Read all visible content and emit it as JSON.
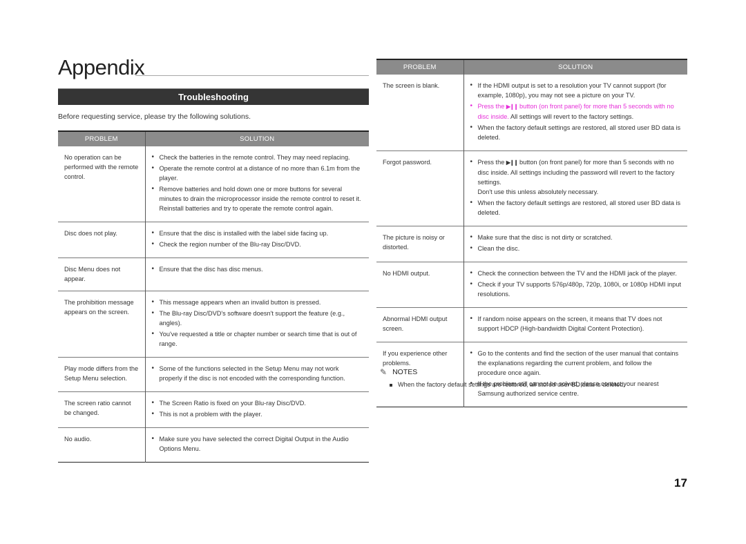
{
  "page": {
    "title": "Appendix",
    "section_title": "Troubleshooting",
    "intro": "Before requesting service, please try the following solutions.",
    "page_number": "17",
    "accent_color": "#e62ed8"
  },
  "table_headers": {
    "problem": "PROBLEM",
    "solution": "SOLUTION"
  },
  "left_table": {
    "rows": [
      {
        "problem": "No operation can be performed with the remote control.",
        "solutions": [
          "Check the batteries in the remote control. They may need replacing.",
          "Operate the remote control at a distance of no more than 6.1m from the player.",
          "Remove batteries and hold down one or more buttons for several minutes to drain the microprocessor inside the remote control to reset it. Reinstall batteries and try to operate the remote control again."
        ]
      },
      {
        "problem": "Disc does not play.",
        "solutions": [
          "Ensure that the disc is installed with the label side facing up.",
          "Check the region number of the Blu-ray Disc/DVD."
        ]
      },
      {
        "problem": "Disc Menu does not appear.",
        "solutions": [
          "Ensure that the disc has disc menus."
        ]
      },
      {
        "problem": "The prohibition message appears on the screen.",
        "solutions": [
          "This message appears when an invalid button is pressed.",
          "The Blu-ray Disc/DVD's software doesn't support the feature (e.g., angles).",
          "You've requested a title or chapter number or search time that is out of range."
        ]
      },
      {
        "problem": "Play mode differs from the Setup Menu selection.",
        "solutions": [
          "Some of the functions selected in the Setup Menu may not work properly if the disc is not encoded with the corresponding function."
        ]
      },
      {
        "problem": "The screen ratio cannot be changed.",
        "solutions": [
          "The Screen Ratio is fixed on your Blu-ray Disc/DVD.",
          "This is not a problem with the player."
        ]
      },
      {
        "problem": "No audio.",
        "solutions": [
          "Make sure you have selected the correct Digital Output in the Audio Options Menu."
        ]
      }
    ]
  },
  "right_table": {
    "rows": [
      {
        "problem": "The screen is blank.",
        "solutions": [
          {
            "text": "If the HDMI output is set to a resolution your TV cannot support (for example, 1080p), you may not see a picture on your TV."
          },
          {
            "highlight_pre": "Press the ",
            "icon": "▶❙❙",
            "highlight_post": " button (on front panel) for more than 5 seconds with no disc inside.",
            "text": " All settings will revert to the factory settings."
          },
          {
            "text": "When the factory default settings are restored, all stored user BD data is deleted."
          }
        ]
      },
      {
        "problem": "Forgot password.",
        "solutions": [
          {
            "pre": "Press the ",
            "icon": "▶❙❙",
            "text": " button (on front panel) for more than 5 seconds with no disc inside. All settings including the password will revert to the factory settings.",
            "extra": "Don't use this unless absolutely necessary."
          },
          {
            "text": "When the factory default settings are restored, all stored user BD data is deleted."
          }
        ]
      },
      {
        "problem": "The picture is noisy or distorted.",
        "solutions": [
          {
            "text": "Make sure that the disc is not dirty or scratched."
          },
          {
            "text": "Clean the disc."
          }
        ]
      },
      {
        "problem": "No HDMI output.",
        "solutions": [
          {
            "text": "Check the connection between the TV and the HDMI jack of the player."
          },
          {
            "text": "Check if your TV supports 576p/480p, 720p, 1080i, or 1080p HDMI input resolutions."
          }
        ]
      },
      {
        "problem": "Abnormal HDMI output screen.",
        "solutions": [
          {
            "text": "If random noise appears on the screen, it means that TV does not support HDCP (High-bandwidth Digital Content Protection)."
          }
        ]
      },
      {
        "problem": "If you experience other problems.",
        "solutions": [
          {
            "text": "Go to the contents and find the section of the user manual that contains the explanations regarding the current problem, and follow the procedure once again."
          },
          {
            "text": "If the problem still cannot be solved, please contact your nearest Samsung authorized service centre."
          }
        ]
      }
    ]
  },
  "notes": {
    "icon": "pencil-icon",
    "title": "NOTES",
    "items": [
      "When the factory default settings are restored, all stored user BD data is deleted."
    ]
  }
}
